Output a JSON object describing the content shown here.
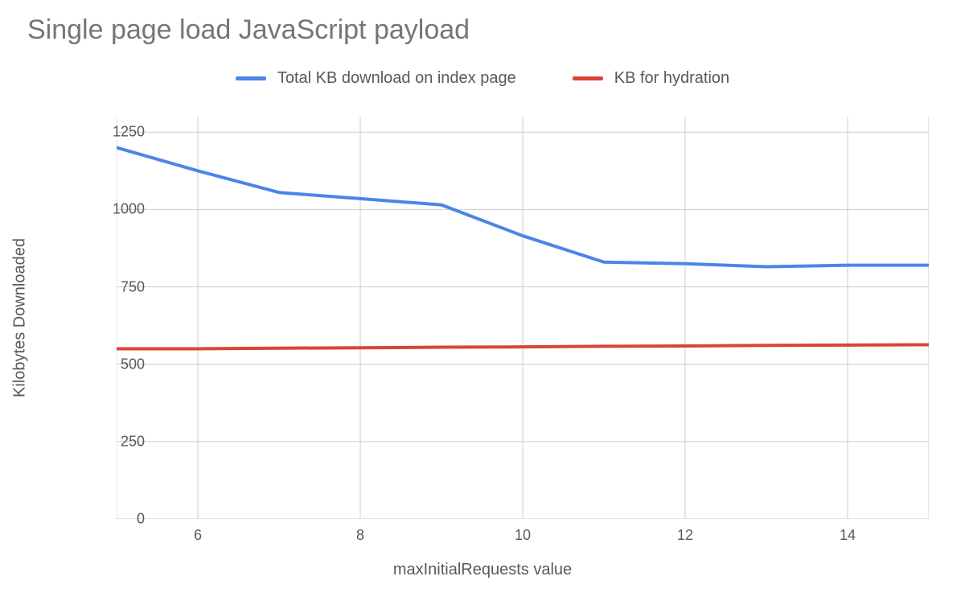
{
  "chart_data": {
    "type": "line",
    "title": "Single page load JavaScript payload",
    "xlabel": "maxInitialRequests value",
    "ylabel": "Kilobytes Downloaded",
    "x": [
      5,
      6,
      7,
      8,
      9,
      10,
      11,
      12,
      13,
      14,
      15
    ],
    "x_ticks": [
      6,
      8,
      10,
      12,
      14
    ],
    "y_ticks": [
      0,
      250,
      500,
      750,
      1000,
      1250
    ],
    "xlim": [
      5,
      15
    ],
    "ylim": [
      0,
      1300
    ],
    "series": [
      {
        "name": "Total KB download on index page",
        "color": "#4a86e8",
        "values": [
          1200,
          1125,
          1055,
          1035,
          1015,
          915,
          830,
          825,
          815,
          820,
          820
        ]
      },
      {
        "name": "KB for hydration",
        "color": "#db4437",
        "values": [
          550,
          550,
          552,
          553,
          555,
          556,
          558,
          559,
          561,
          562,
          563
        ]
      }
    ]
  }
}
